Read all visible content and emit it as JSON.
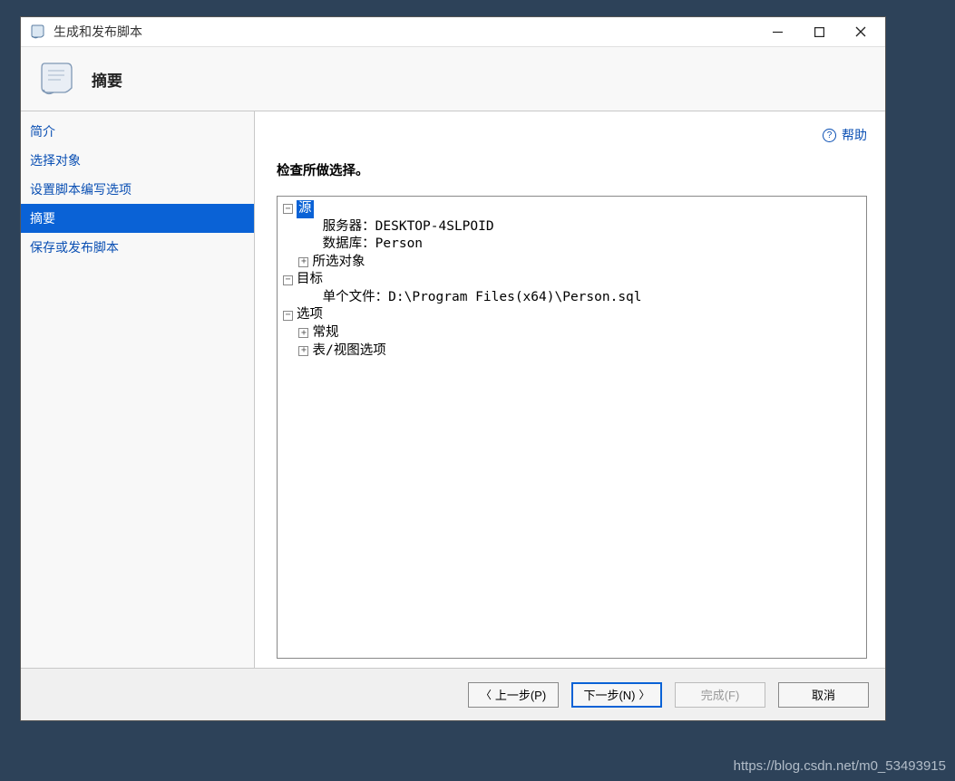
{
  "window": {
    "title": "生成和发布脚本",
    "heading": "摘要"
  },
  "sidebar": {
    "items": [
      {
        "label": "简介"
      },
      {
        "label": "选择对象"
      },
      {
        "label": "设置脚本编写选项"
      },
      {
        "label": "摘要"
      },
      {
        "label": "保存或发布脚本"
      }
    ],
    "active_index": 3
  },
  "help": {
    "label": "帮助"
  },
  "content": {
    "subtitle": "检查所做选择。",
    "tree": {
      "source": {
        "label": "源",
        "server_label": "服务器：",
        "server_value": "DESKTOP-4SLPOID",
        "database_label": "数据库：",
        "database_value": "Person",
        "selected_objects_label": "所选对象"
      },
      "target": {
        "label": "目标",
        "single_file_label": "单个文件：",
        "single_file_value": "D:\\Program Files(x64)\\Person.sql"
      },
      "options": {
        "label": "选项",
        "general_label": "常规",
        "table_view_label": "表/视图选项"
      }
    }
  },
  "buttons": {
    "prev": "上一步(P)",
    "next": "下一步(N)",
    "finish": "完成(F)",
    "cancel": "取消"
  },
  "watermark": "https://blog.csdn.net/m0_53493915"
}
